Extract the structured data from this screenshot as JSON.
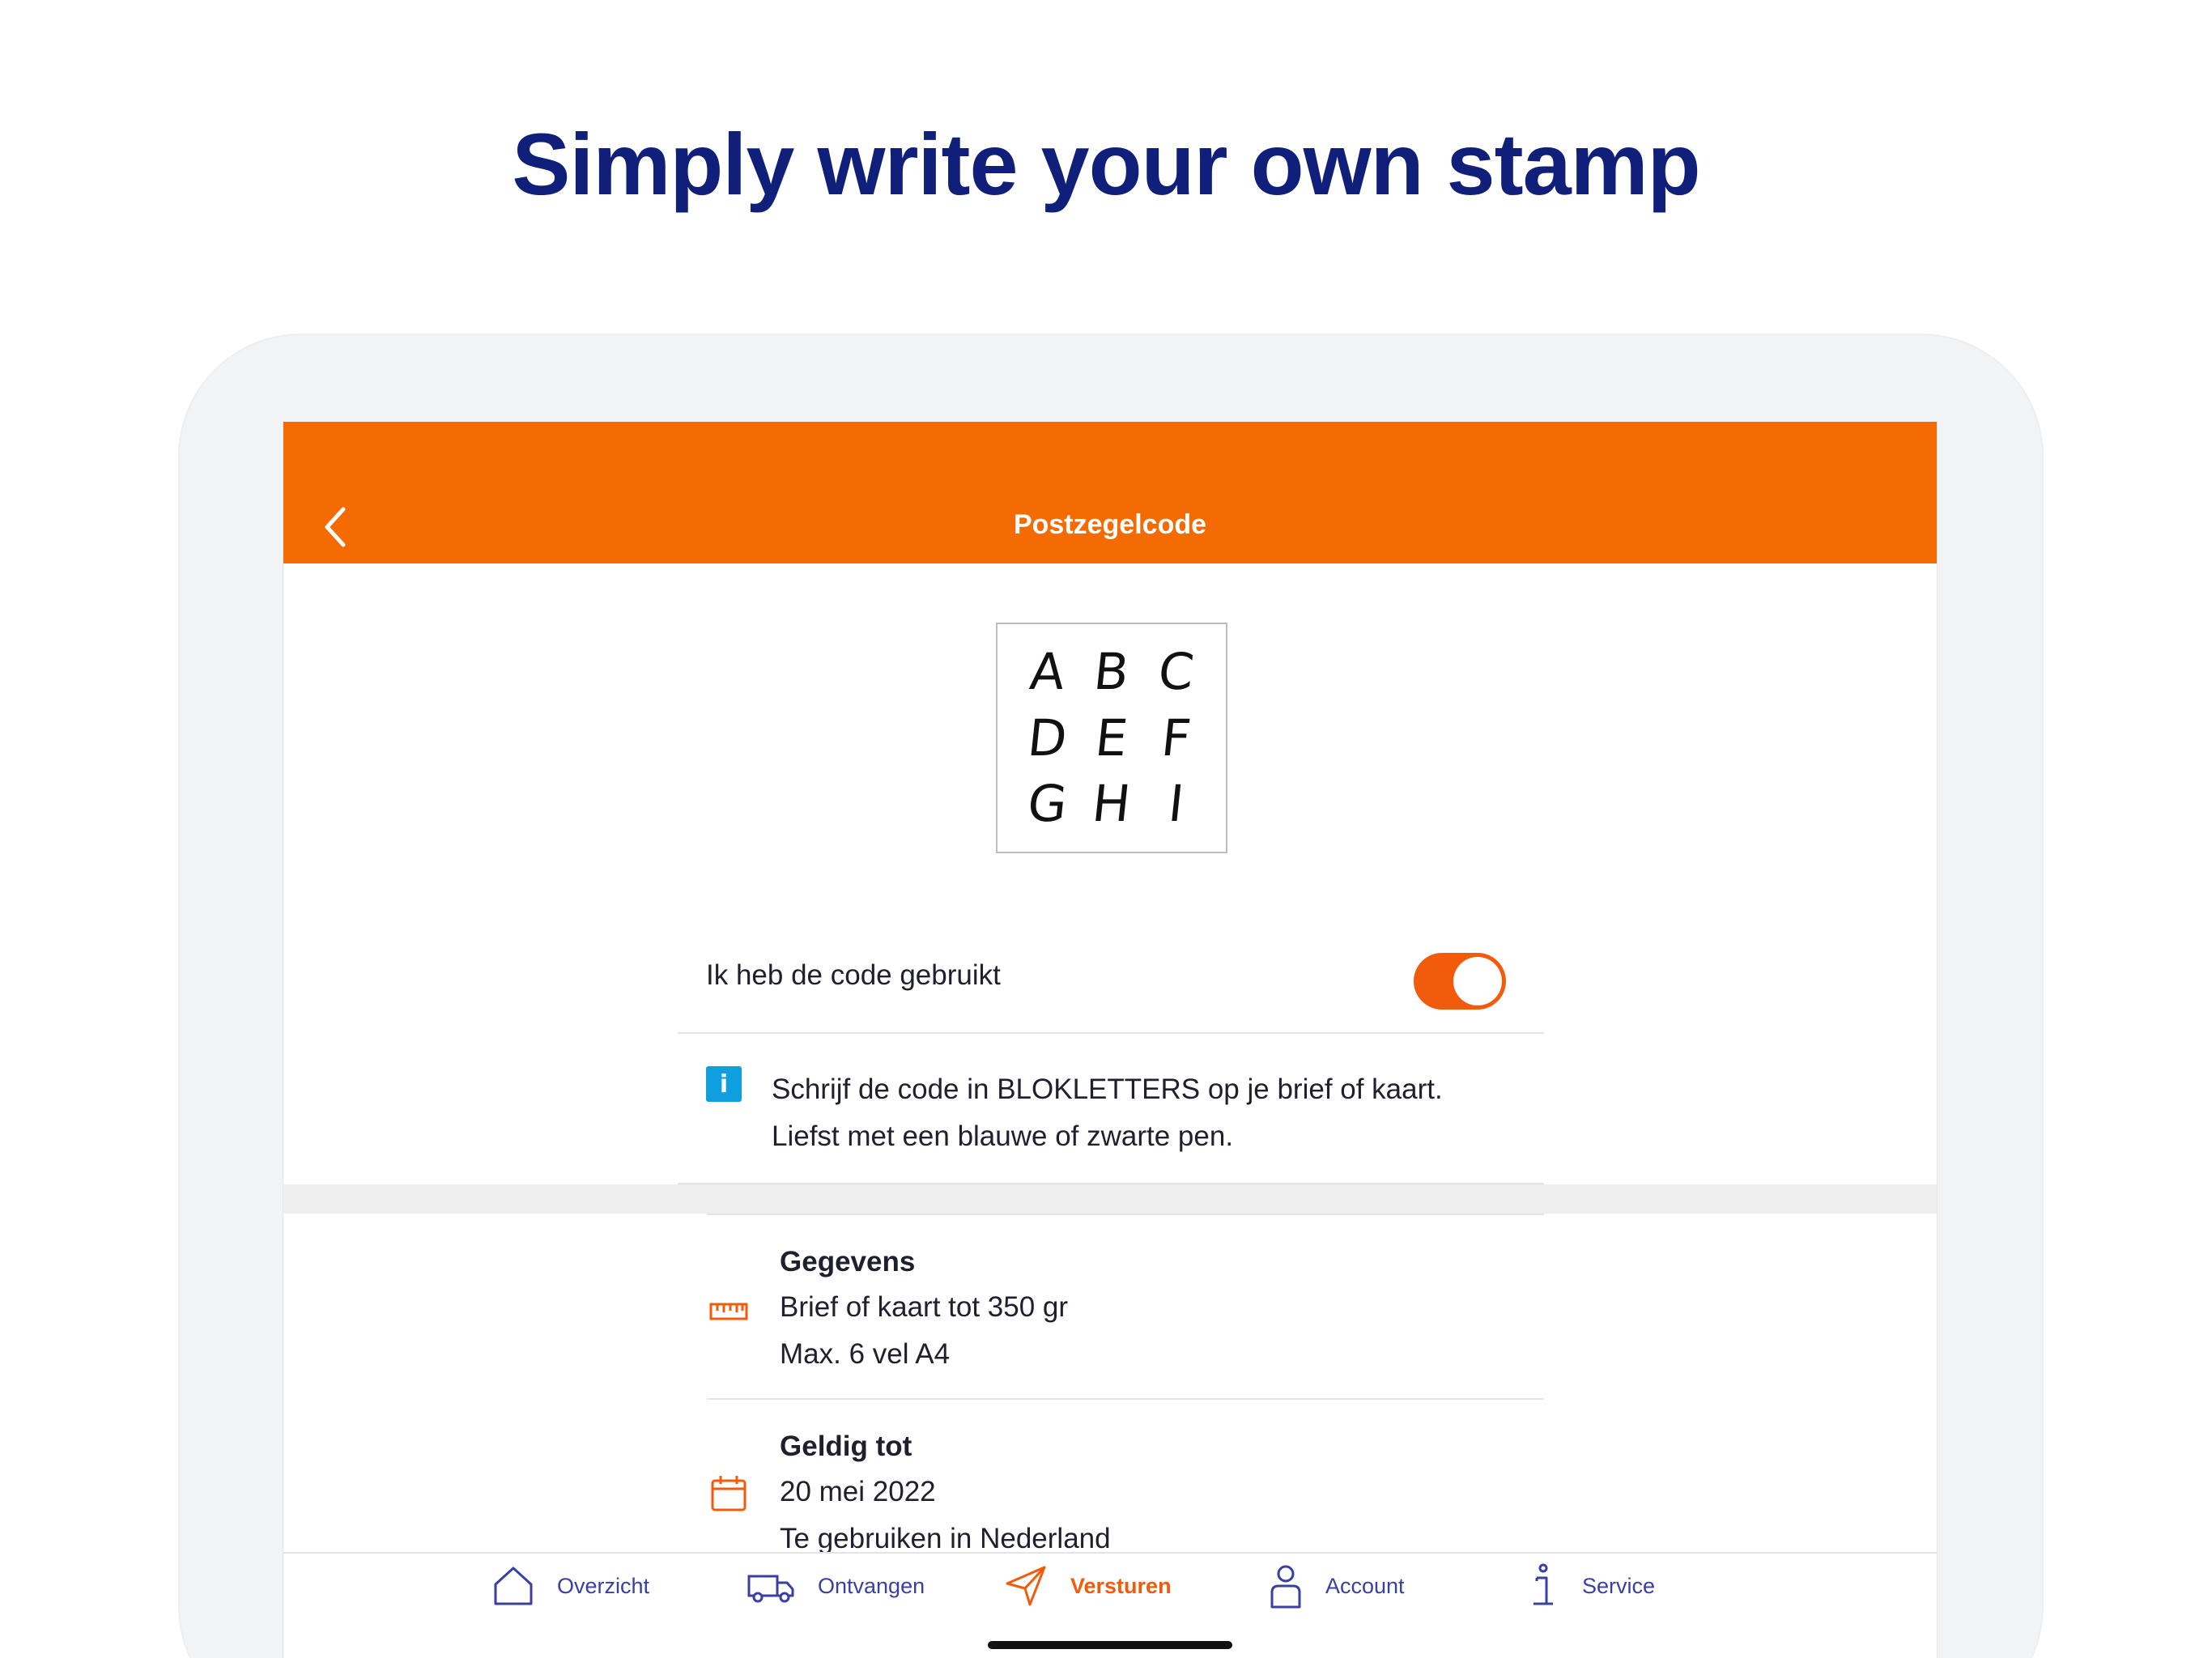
{
  "headline": "Simply write your own stamp",
  "app_bar": {
    "title": "Postzegelcode",
    "back_icon": "chevron-left-icon"
  },
  "stamp_code": {
    "characters": [
      "A",
      "B",
      "C",
      "D",
      "E",
      "F",
      "G",
      "H",
      "I"
    ]
  },
  "used_toggle": {
    "label": "Ik heb de code gebruikt",
    "state": "on"
  },
  "info": {
    "icon": "info-icon",
    "icon_glyph": "i",
    "line1": "Schrijf de code in BLOKLETTERS op je brief of kaart.",
    "line2": "Liefst met een blauwe of zwarte pen."
  },
  "details": [
    {
      "icon": "ruler-icon",
      "title": "Gegevens",
      "line1": "Brief of kaart tot 350 gr",
      "line2": "Max. 6 vel A4"
    },
    {
      "icon": "calendar-icon",
      "title": "Geldig tot",
      "line1": "20 mei 2022",
      "line2": "Te gebruiken in Nederland"
    }
  ],
  "tabs": [
    {
      "label": "Overzicht",
      "icon": "home-icon",
      "active": false
    },
    {
      "label": "Ontvangen",
      "icon": "delivery-van-icon",
      "active": false
    },
    {
      "label": "Versturen",
      "icon": "send-icon",
      "active": true
    },
    {
      "label": "Account",
      "icon": "person-icon",
      "active": false
    },
    {
      "label": "Service",
      "icon": "info-service-icon",
      "active": false
    }
  ],
  "colors": {
    "brand_orange": "#f46a03",
    "headline_blue": "#0f1f7a",
    "tab_blue": "#3a3fa3",
    "info_blue": "#0f9ee0"
  }
}
